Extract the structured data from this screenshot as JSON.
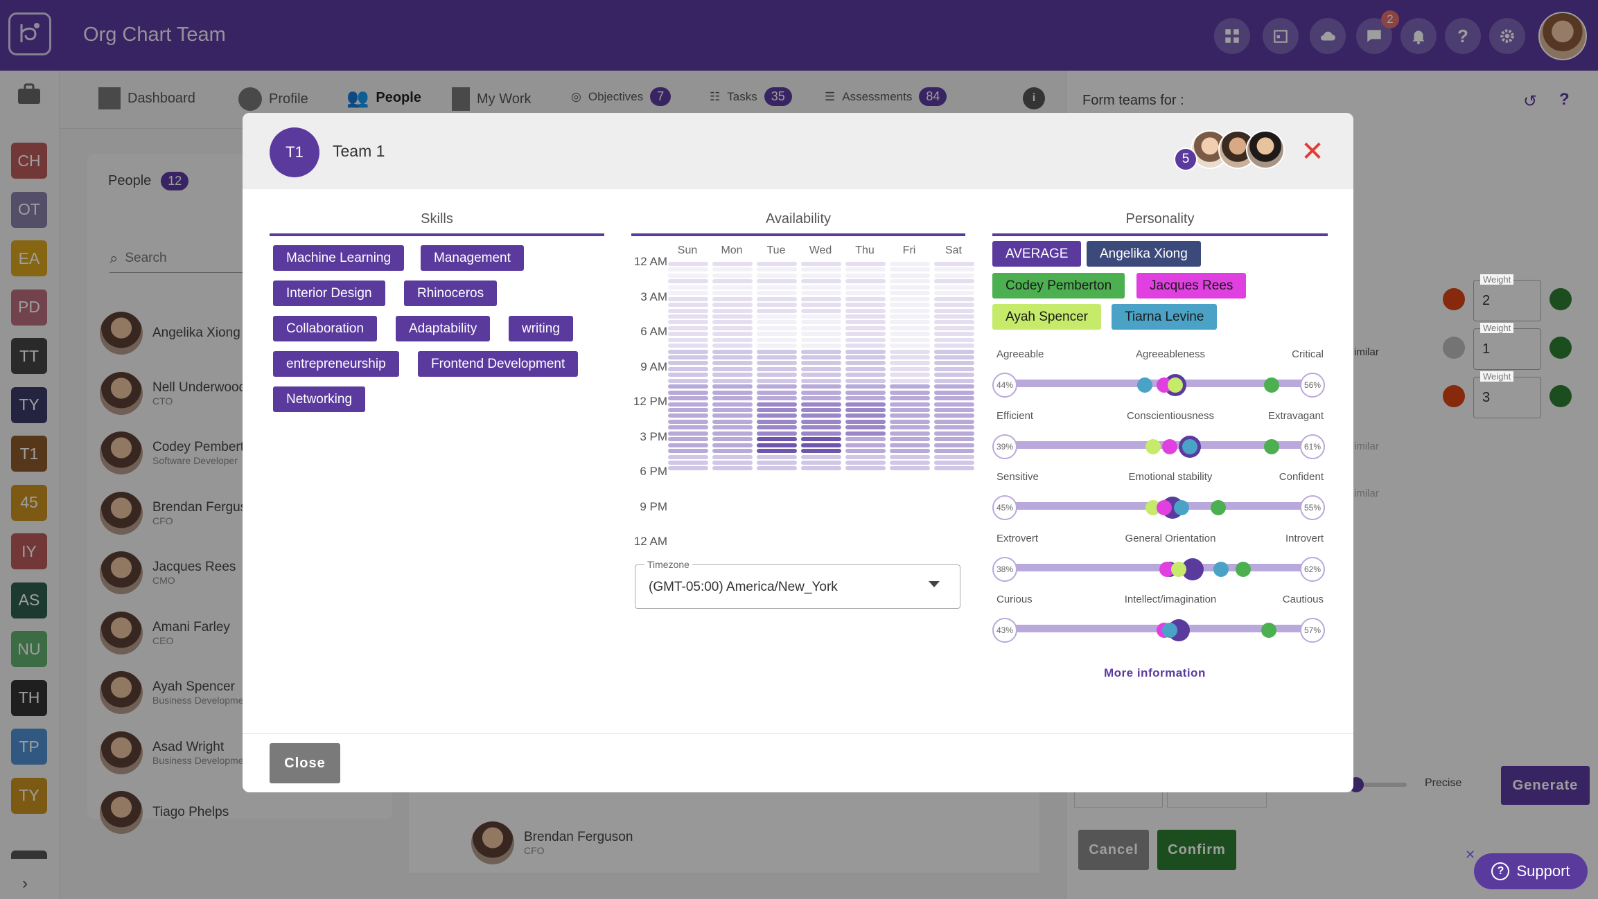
{
  "app": {
    "title": "Org Chart Team",
    "notification_count": "2"
  },
  "colors": {
    "brand": "#5b3a9e",
    "danger": "#e53935"
  },
  "top_icons": [
    "dashboard-grid-icon",
    "calendar-icon",
    "cloud-icon",
    "chat-icon",
    "bell-icon",
    "help-icon",
    "gear-icon"
  ],
  "sidebar": {
    "orgs": [
      {
        "label": "CH",
        "color": "#b85a5a"
      },
      {
        "label": "OT",
        "color": "#8a7fa8"
      },
      {
        "label": "EA",
        "color": "#d9a520"
      },
      {
        "label": "PD",
        "color": "#b86b7c"
      },
      {
        "label": "TT",
        "color": "#444444"
      },
      {
        "label": "TY",
        "color": "#3b3a6a"
      },
      {
        "label": "T1",
        "color": "#8b5a2b"
      },
      {
        "label": "45",
        "color": "#c9921f"
      },
      {
        "label": "IY",
        "color": "#b85a5a"
      },
      {
        "label": "AS",
        "color": "#2f5e4f"
      },
      {
        "label": "NU",
        "color": "#5fae6e"
      },
      {
        "label": "TH",
        "color": "#333333"
      },
      {
        "label": "TP",
        "color": "#4e8fd1"
      },
      {
        "label": "TY",
        "color": "#c9921f"
      }
    ]
  },
  "nav": {
    "dashboard": "Dashboard",
    "profile": "Profile",
    "people": "People",
    "my_work": "My Work",
    "objectives": "Objectives",
    "objectives_count": "7",
    "tasks": "Tasks",
    "tasks_count": "35",
    "assessments": "Assessments",
    "assessments_count": "84"
  },
  "people_panel": {
    "title": "People",
    "count": "12",
    "search_placeholder": "Search",
    "list": [
      {
        "name": "Angelika Xiong",
        "role": ""
      },
      {
        "name": "Nell Underwood",
        "role": "CTO"
      },
      {
        "name": "Codey Pemberton",
        "role": "Software Developer"
      },
      {
        "name": "Brendan Ferguson",
        "role": "CFO"
      },
      {
        "name": "Jacques Rees",
        "role": "CMO"
      },
      {
        "name": "Amani Farley",
        "role": "CEO"
      },
      {
        "name": "Ayah Spencer",
        "role": "Business Development"
      },
      {
        "name": "Asad Wright",
        "role": "Business Development"
      },
      {
        "name": "Tiago Phelps",
        "role": ""
      }
    ],
    "bg_person": {
      "name": "Brendan Ferguson",
      "role": "CFO"
    }
  },
  "right_panel": {
    "form_teams": "Form teams for :",
    "weight_label": "Weight",
    "weights": [
      "2",
      "1",
      "3"
    ],
    "precise": "Precise",
    "generate": "Generate",
    "cancel": "Cancel",
    "confirm": "Confirm",
    "similar": "imilar"
  },
  "modal": {
    "team_initials": "T1",
    "team_name": "Team 1",
    "member_count": "5",
    "skills_title": "Skills",
    "availability_title": "Availability",
    "personality_title": "Personality",
    "skills": [
      "Machine Learning",
      "Management",
      "Interior Design",
      "Rhinoceros",
      "Collaboration",
      "Adaptability",
      "writing",
      "entrepreneurship",
      "Frontend Development",
      "Networking"
    ],
    "days": [
      "Sun",
      "Mon",
      "Tue",
      "Wed",
      "Thu",
      "Fri",
      "Sat"
    ],
    "hours": [
      "12 AM",
      "3 AM",
      "6 AM",
      "9 AM",
      "12 PM",
      "3 PM",
      "6 PM",
      "9 PM",
      "12 AM"
    ],
    "timezone_label": "Timezone",
    "timezone_value": "(GMT-05:00) America/New_York",
    "personality_members": [
      {
        "name": "AVERAGE",
        "bg": "#5b3a9e",
        "fg": "#ffffff"
      },
      {
        "name": "Angelika Xiong",
        "bg": "#3b4a7a",
        "fg": "#ffffff"
      },
      {
        "name": "Codey Pemberton",
        "bg": "#4caf50",
        "fg": "#1a1a1a"
      },
      {
        "name": "Jacques Rees",
        "bg": "#e040e0",
        "fg": "#1a1a1a"
      },
      {
        "name": "Ayah Spencer",
        "bg": "#c6ea6a",
        "fg": "#1a1a1a"
      },
      {
        "name": "Tiarna Levine",
        "bg": "#4aa3c7",
        "fg": "#1a1a1a"
      }
    ],
    "traits": [
      {
        "left": "Agreeable",
        "name": "Agreeableness",
        "right": "Critical",
        "lpct": "44%",
        "rpct": "56%",
        "avg": 0.56,
        "dots": [
          {
            "c": "#4aa3c7",
            "v": 0.45
          },
          {
            "c": "#e040e0",
            "v": 0.52
          },
          {
            "c": "#c6ea6a",
            "v": 0.56
          },
          {
            "c": "#4caf50",
            "v": 0.9
          }
        ]
      },
      {
        "left": "Efficient",
        "name": "Conscientiousness",
        "right": "Extravagant",
        "lpct": "39%",
        "rpct": "61%",
        "avg": 0.61,
        "dots": [
          {
            "c": "#c6ea6a",
            "v": 0.48
          },
          {
            "c": "#e040e0",
            "v": 0.54
          },
          {
            "c": "#4aa3c7",
            "v": 0.61
          },
          {
            "c": "#4caf50",
            "v": 0.9
          }
        ]
      },
      {
        "left": "Sensitive",
        "name": "Emotional stability",
        "right": "Confident",
        "lpct": "45%",
        "rpct": "55%",
        "avg": 0.55,
        "dots": [
          {
            "c": "#c6ea6a",
            "v": 0.48
          },
          {
            "c": "#e040e0",
            "v": 0.52
          },
          {
            "c": "#4aa3c7",
            "v": 0.58
          },
          {
            "c": "#4caf50",
            "v": 0.71
          }
        ]
      },
      {
        "left": "Extrovert",
        "name": "General Orientation",
        "right": "Introvert",
        "lpct": "38%",
        "rpct": "62%",
        "avg": 0.62,
        "dots": [
          {
            "c": "#3b4a7a",
            "v": 0.54
          },
          {
            "c": "#e040e0",
            "v": 0.53
          },
          {
            "c": "#c6ea6a",
            "v": 0.57
          },
          {
            "c": "#4aa3c7",
            "v": 0.72
          },
          {
            "c": "#4caf50",
            "v": 0.8
          }
        ]
      },
      {
        "left": "Curious",
        "name": "Intellect/imagination",
        "right": "Cautious",
        "lpct": "43%",
        "rpct": "57%",
        "avg": 0.57,
        "dots": [
          {
            "c": "#e040e0",
            "v": 0.52
          },
          {
            "c": "#4aa3c7",
            "v": 0.54
          },
          {
            "c": "#4caf50",
            "v": 0.89
          }
        ]
      }
    ],
    "more_info": "More information",
    "close_label": "Close"
  },
  "support": "Support"
}
